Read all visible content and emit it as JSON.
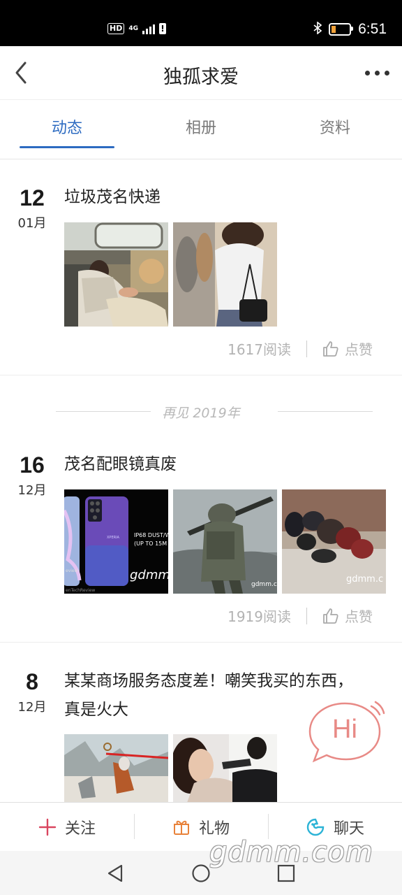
{
  "status_bar": {
    "hd": "HD",
    "network": "4G",
    "time": "6:51"
  },
  "header": {
    "title": "独孤求爱"
  },
  "tabs": [
    {
      "label": "动态",
      "active": true
    },
    {
      "label": "相册",
      "active": false
    },
    {
      "label": "资料",
      "active": false
    }
  ],
  "posts": [
    {
      "day": "12",
      "month": "01月",
      "title": "垃圾茂名快递",
      "reads": "1617阅读",
      "like_label": "点赞"
    },
    {
      "day": "16",
      "month": "12月",
      "title": "茂名配眼镜真废",
      "reads": "1919阅读",
      "like_label": "点赞",
      "image_texts": [
        "XPERIA",
        "IP68 DUST/W",
        "(UP TO 15M",
        "gdmm",
        "gdmm.co",
        "gdmm.c",
        "enTechReview",
        "eview"
      ]
    },
    {
      "day": "8",
      "month": "12月",
      "title_line1": "某某商场服务态度差！嘲笑我买的东西，",
      "title_line2": "真是火大"
    }
  ],
  "year_divider": "再见 2019年",
  "hi_bubble": "Hi",
  "actions": [
    {
      "label": "关注",
      "icon": "plus-icon"
    },
    {
      "label": "礼物",
      "icon": "gift-icon"
    },
    {
      "label": "聊天",
      "icon": "chat-icon"
    }
  ],
  "watermark": "gdmm.com",
  "colors": {
    "accent": "#2d6bc1",
    "follow": "#d9455f",
    "gift": "#e8823a",
    "chat": "#2bb3d6",
    "hi": "#e88a86"
  }
}
